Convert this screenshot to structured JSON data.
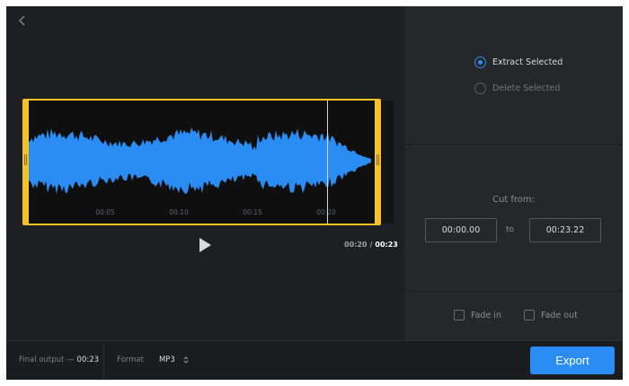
{
  "editor": {
    "ticks": [
      "00:05",
      "00:10",
      "00:15",
      "00:20"
    ],
    "playback": {
      "current": "00:20",
      "separator": "/",
      "total": "00:23"
    },
    "selection_color": "#f5c226",
    "wave_color": "#2b8df4"
  },
  "mode": {
    "options": [
      {
        "label": "Extract Selected",
        "selected": true
      },
      {
        "label": "Delete Selected",
        "selected": false
      }
    ]
  },
  "cut": {
    "title": "Cut from:",
    "from": "00:00.00",
    "to_label": "to",
    "to": "00:23.22"
  },
  "fade": {
    "fade_in": {
      "label": "Fade in",
      "checked": false
    },
    "fade_out": {
      "label": "Fade out",
      "checked": false
    }
  },
  "bottom": {
    "final_output_label": "Final output —",
    "final_output_value": "00:23",
    "format_label": "Format",
    "format_value": "MP3",
    "export_label": "Export"
  },
  "colors": {
    "accent": "#2b8df4",
    "background": "#1e1f22",
    "panel": "#26272b"
  }
}
